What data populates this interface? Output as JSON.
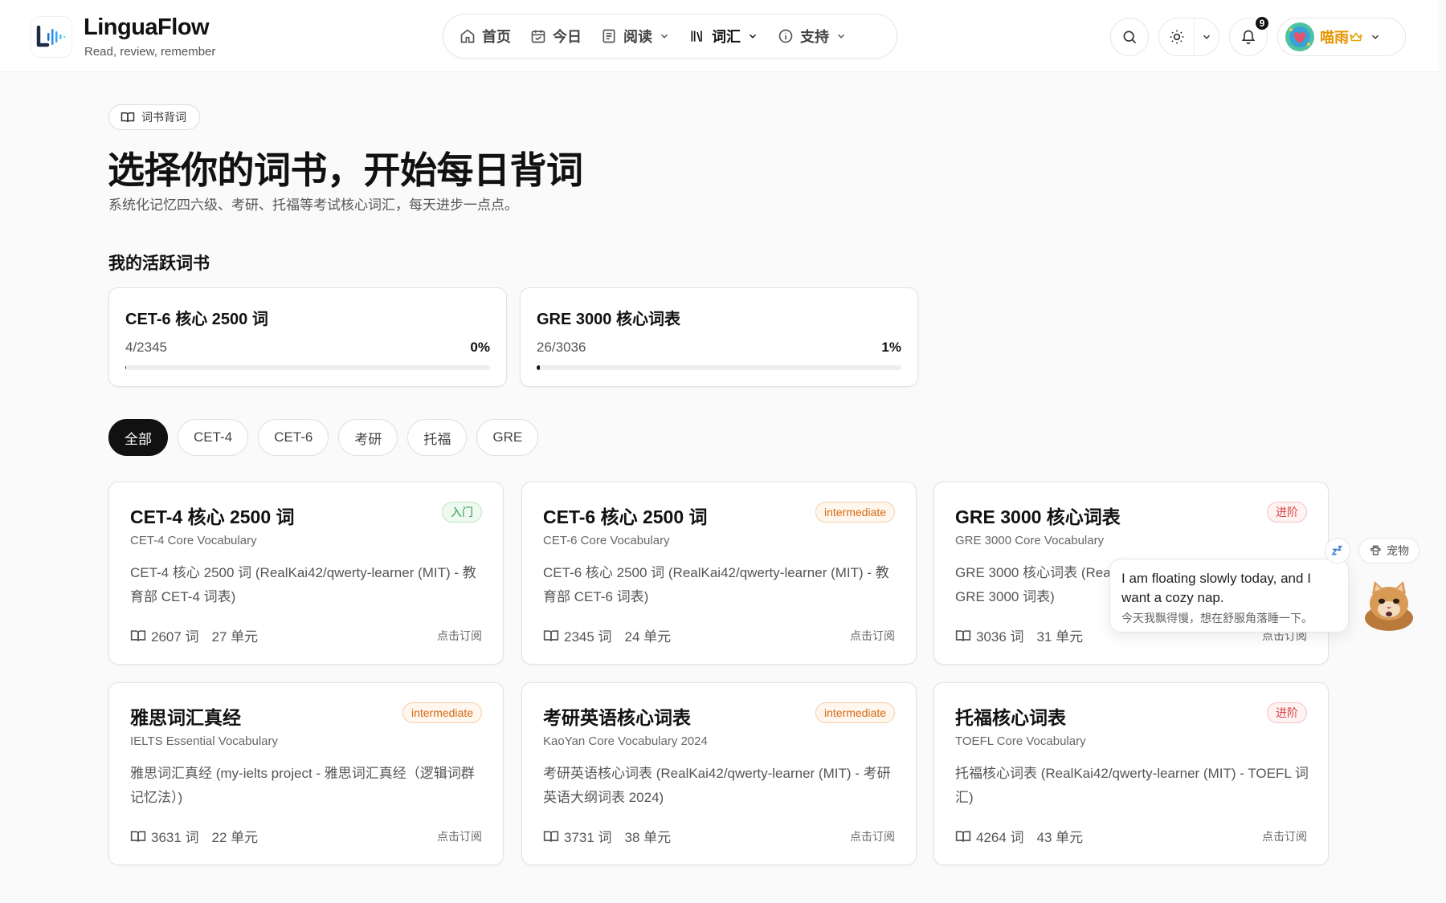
{
  "brand": {
    "name": "LinguaFlow",
    "tagline": "Read, review, remember"
  },
  "nav": [
    {
      "label": "首页",
      "icon": "home-icon"
    },
    {
      "label": "今日",
      "icon": "calendar-icon"
    },
    {
      "label": "阅读",
      "icon": "book-icon",
      "dropdown": true
    },
    {
      "label": "词汇",
      "icon": "library-icon",
      "dropdown": true,
      "active": true
    },
    {
      "label": "支持",
      "icon": "info-icon",
      "dropdown": true
    }
  ],
  "header": {
    "notifications_count": "9",
    "user_name": "喵雨",
    "icons": [
      "search-icon",
      "sun-icon",
      "chevron-down-icon",
      "bell-icon",
      "crown-icon"
    ]
  },
  "page": {
    "section_label": "词书背词",
    "title": "选择你的词书，开始每日背词",
    "subtitle": "系统化记忆四六级、考研、托福等考试核心词汇，每天进步一点点。",
    "active_heading": "我的活跃词书"
  },
  "active_books": [
    {
      "title": "CET-6 核心 2500 词",
      "count": "4/2345",
      "percent": "0%",
      "progress": 0.17
    },
    {
      "title": "GRE 3000 核心词表",
      "count": "26/3036",
      "percent": "1%",
      "progress": 0.86
    }
  ],
  "filters": [
    {
      "label": "全部",
      "active": true
    },
    {
      "label": "CET-4"
    },
    {
      "label": "CET-6"
    },
    {
      "label": "考研"
    },
    {
      "label": "托福"
    },
    {
      "label": "GRE"
    }
  ],
  "books": [
    {
      "title": "CET-4 核心 2500 词",
      "subtitle": "CET-4 Core Vocabulary",
      "description": "CET-4 核心 2500 词 (RealKai42/qwerty-learner (MIT) - 教育部 CET-4 词表)",
      "words": "2607 词",
      "units": "27 单元",
      "tag": "入门",
      "tag_color": "#2f9a4a",
      "action": "点击订阅"
    },
    {
      "title": "CET-6 核心 2500 词",
      "subtitle": "CET-6 Core Vocabulary",
      "description": "CET-6 核心 2500 词 (RealKai42/qwerty-learner (MIT) - 教育部 CET-6 词表)",
      "words": "2345 词",
      "units": "24 单元",
      "tag": "intermediate",
      "tag_color": "#d56a12",
      "action": "点击订阅"
    },
    {
      "title": "GRE 3000 核心词表",
      "subtitle": "GRE 3000 Core Vocabulary",
      "description": "GRE 3000 核心词表 (Rea",
      "description_line2": "GRE 3000 词表)",
      "words": "3036 词",
      "units": "31 单元",
      "tag": "进阶",
      "tag_color": "#d64545",
      "action": "点击订阅"
    },
    {
      "title": "雅思词汇真经",
      "subtitle": "IELTS Essential Vocabulary",
      "description": "雅思词汇真经 (my-ielts project - 雅思词汇真经（逻辑词群记忆法）)",
      "words": "3631 词",
      "units": "22 单元",
      "tag": "intermediate",
      "tag_color": "#d56a12",
      "action": "点击订阅"
    },
    {
      "title": "考研英语核心词表",
      "subtitle": "KaoYan Core Vocabulary 2024",
      "description": "考研英语核心词表 (RealKai42/qwerty-learner (MIT) - 考研英语大纲词表 2024)",
      "words": "3731 词",
      "units": "38 单元",
      "tag": "intermediate",
      "tag_color": "#d56a12",
      "action": "点击订阅"
    },
    {
      "title": "托福核心词表",
      "subtitle": "TOEFL Core Vocabulary",
      "description": "托福核心词表 (RealKai42/qwerty-learner (MIT) - TOEFL 词汇)",
      "words": "4264 词",
      "units": "43 单元",
      "tag": "进阶",
      "tag_color": "#d64545",
      "action": "点击订阅"
    }
  ],
  "pet": {
    "button_label": "宠物",
    "message_en": "I am floating slowly today, and I want a cozy nap.",
    "message_zh": "今天我飘得慢，想在舒服角落睡一下。",
    "icons": [
      "sleep-icon",
      "paw-icon",
      "cat-avatar"
    ]
  }
}
